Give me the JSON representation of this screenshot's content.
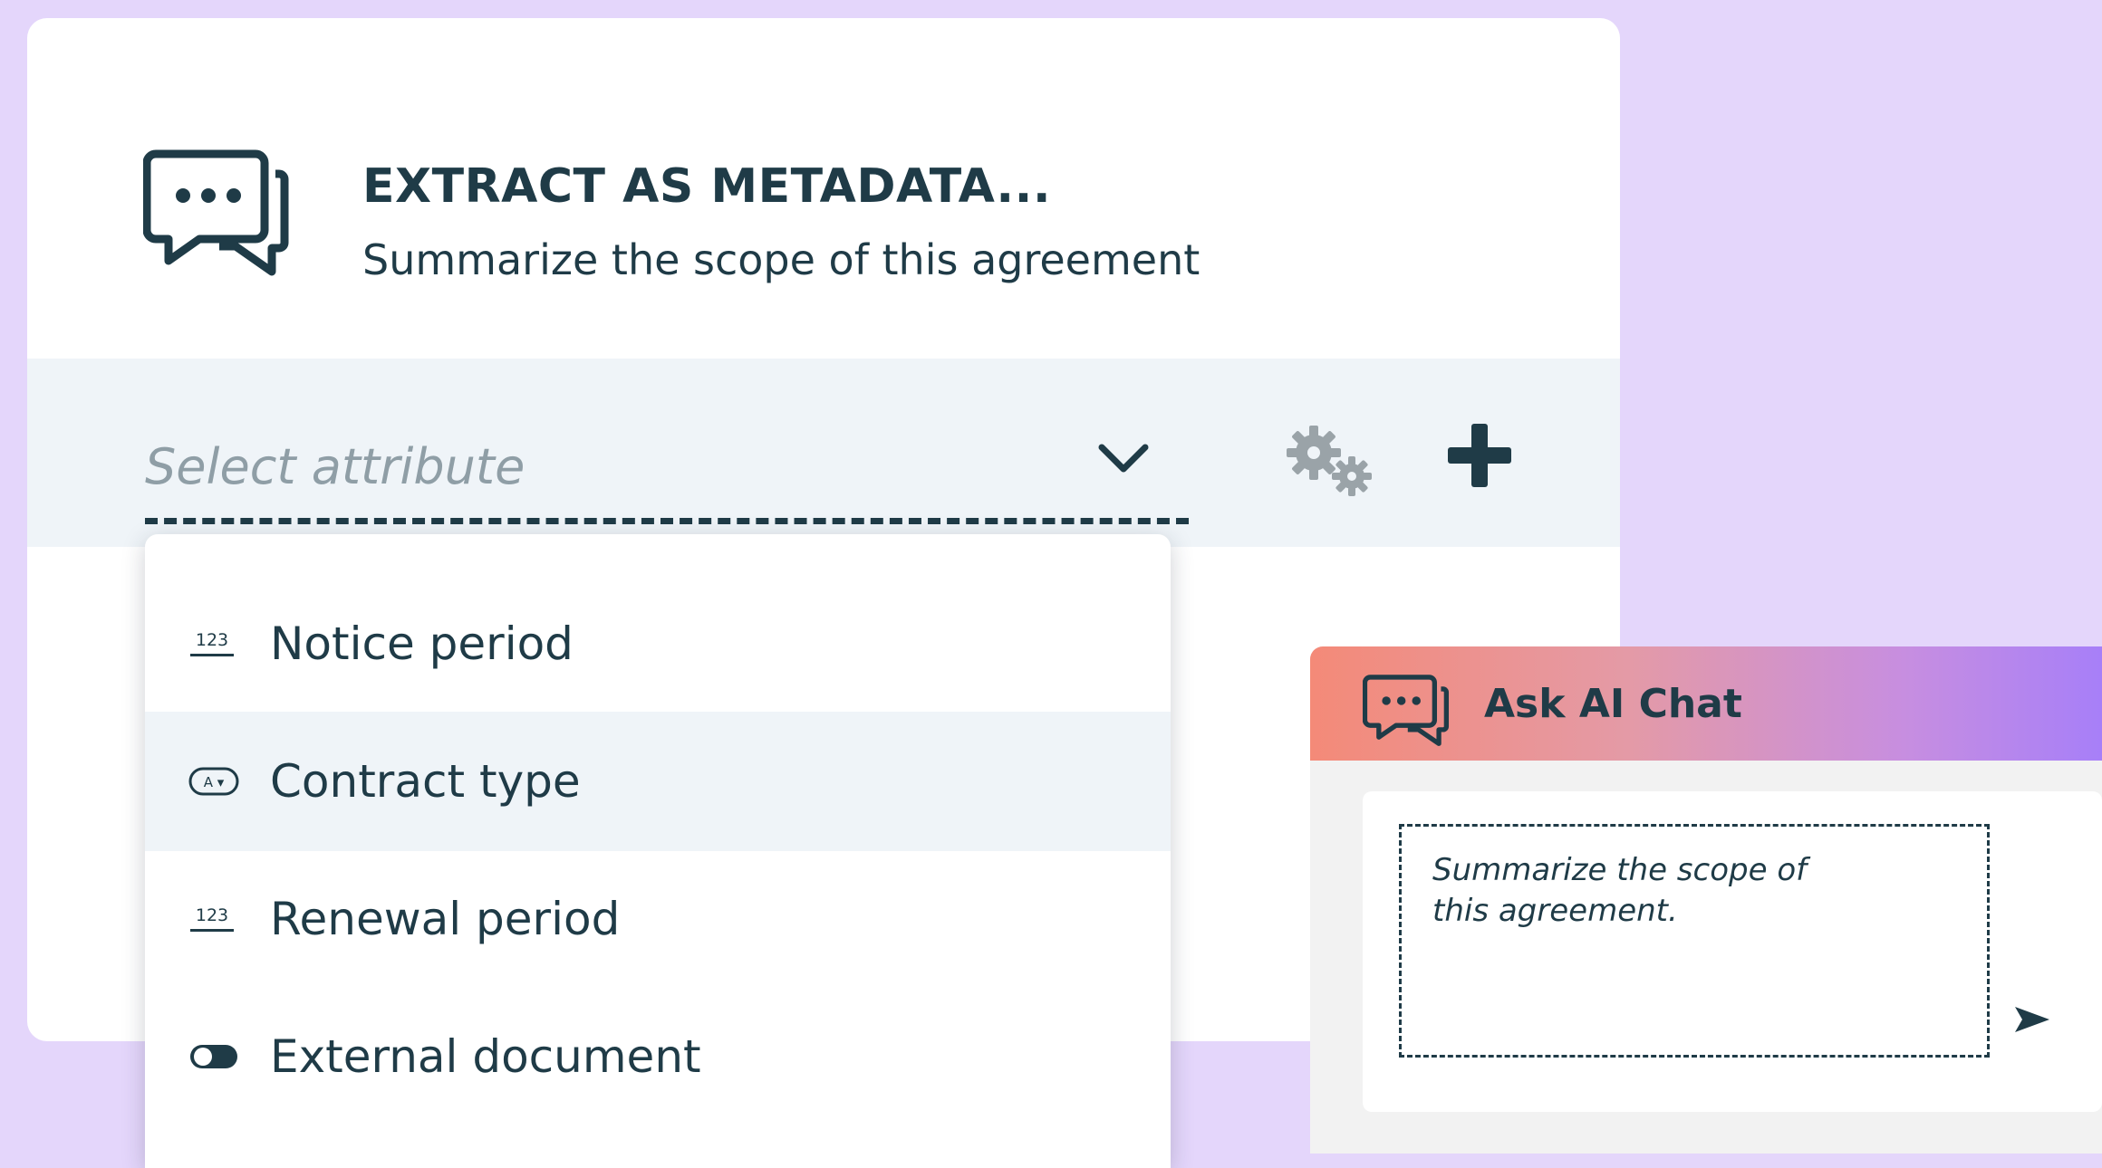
{
  "header": {
    "icon": "chat-bubbles-icon",
    "title": "EXTRACT AS METADATA...",
    "subtitle": "Summarize the scope of this agreement"
  },
  "attribute_bar": {
    "placeholder": "Select attribute",
    "dropdown_icon": "chevron-down-icon",
    "settings_icon": "gears-icon",
    "add_icon": "plus-icon"
  },
  "dropdown": {
    "options": [
      {
        "label": "Notice period",
        "icon": "number-icon",
        "icon_text": "123",
        "highlighted": false
      },
      {
        "label": "Contract type",
        "icon": "select-icon",
        "icon_text": "A ▾",
        "highlighted": true
      },
      {
        "label": "Renewal period",
        "icon": "number-icon",
        "icon_text": "123",
        "highlighted": false
      },
      {
        "label": "External document",
        "icon": "toggle-icon",
        "highlighted": false
      }
    ]
  },
  "chat": {
    "icon": "chat-bubbles-icon",
    "title": "Ask AI Chat",
    "input_text": "Summarize the scope of this agreement.",
    "send_icon": "send-icon"
  },
  "colors": {
    "background": "#e4d6fb",
    "text": "#1f3b47",
    "bar": "#eff4f8",
    "chat_gradient_start": "#f48a78",
    "chat_gradient_end": "#a77ff8"
  }
}
